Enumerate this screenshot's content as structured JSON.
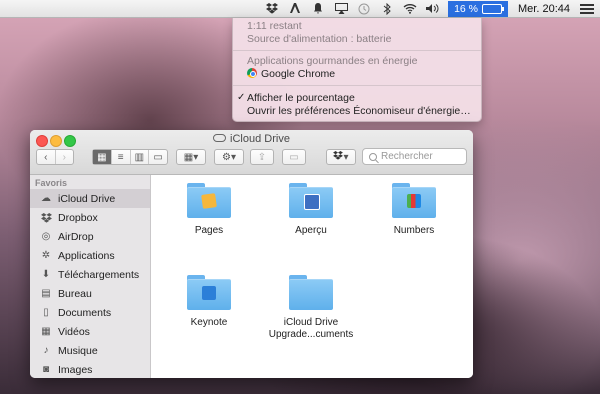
{
  "menubar": {
    "icons": [
      "dropbox-icon",
      "adobe-icon",
      "notification-icon",
      "airplay-icon",
      "time-machine-icon",
      "bluetooth-icon",
      "wifi-icon",
      "volume-icon"
    ],
    "battery_percent_label": "16 %",
    "battery_level": 0.16,
    "clock": "Mer. 20:44"
  },
  "battery_menu": {
    "time_remaining": "1:11 restant",
    "power_source": "Source d'alimentation : batterie",
    "energy_header": "Applications gourmandes en énergie",
    "energy_apps": [
      "Google Chrome"
    ],
    "show_percentage": "Afficher le pourcentage",
    "show_percentage_checked": true,
    "open_prefs": "Ouvrir les préférences Économiseur d'énergie…"
  },
  "window": {
    "title": "iCloud Drive",
    "search_placeholder": "Rechercher"
  },
  "sidebar": {
    "header": "Favoris",
    "items": [
      {
        "label": "iCloud Drive",
        "icon": "cloud-icon",
        "selected": true
      },
      {
        "label": "Dropbox",
        "icon": "dropbox-icon",
        "selected": false
      },
      {
        "label": "AirDrop",
        "icon": "airdrop-icon",
        "selected": false
      },
      {
        "label": "Applications",
        "icon": "applications-icon",
        "selected": false
      },
      {
        "label": "Téléchargements",
        "icon": "downloads-icon",
        "selected": false
      },
      {
        "label": "Bureau",
        "icon": "desktop-icon",
        "selected": false
      },
      {
        "label": "Documents",
        "icon": "documents-icon",
        "selected": false
      },
      {
        "label": "Vidéos",
        "icon": "movies-icon",
        "selected": false
      },
      {
        "label": "Musique",
        "icon": "music-icon",
        "selected": false
      },
      {
        "label": "Images",
        "icon": "pictures-icon",
        "selected": false
      }
    ]
  },
  "files": [
    {
      "label": "Pages",
      "label2": "",
      "emblem": "pages-icon"
    },
    {
      "label": "Aperçu",
      "label2": "",
      "emblem": "apercu-icon"
    },
    {
      "label": "Numbers",
      "label2": "",
      "emblem": "numbers-icon"
    },
    {
      "label": "Keynote",
      "label2": "",
      "emblem": "keynote-icon"
    },
    {
      "label": "iCloud Drive",
      "label2": "Upgrade...cuments",
      "emblem": ""
    }
  ],
  "colors": {
    "accent": "#2a6fe0",
    "folder": "#6ab4ee",
    "sidebar_bg": "#e7e5e7"
  }
}
